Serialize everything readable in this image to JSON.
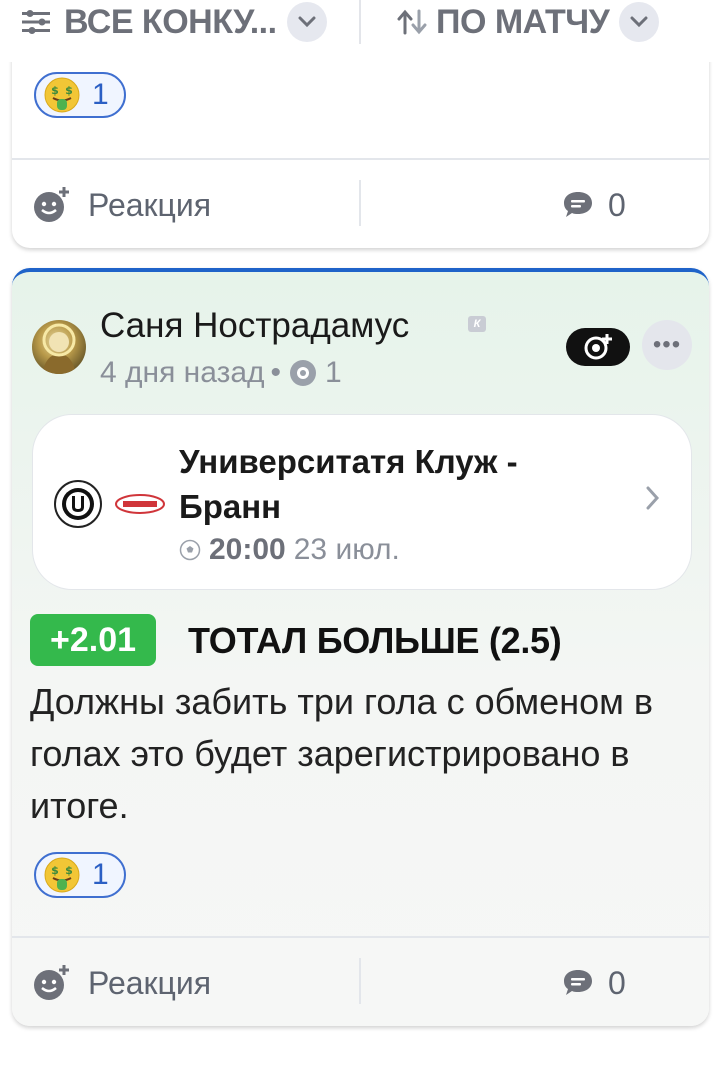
{
  "topbar": {
    "filter_label": "ВСЕ КОНКУ...",
    "sort_label": "ПО МАТЧУ"
  },
  "prev_post": {
    "reaction_count": "1",
    "reaction_label": "Реакция",
    "comments_count": "0"
  },
  "post": {
    "author": "Саня Нострадамус",
    "author_badge": "К",
    "time_ago": "4 дня назад",
    "views": "1",
    "match": {
      "title": "Университатя Клуж - Бранн",
      "time": "20:00",
      "date": "23 июл."
    },
    "odds": "+2.01",
    "bet": "ТОТАЛ БОЛЬШЕ (2.5)",
    "text": "Должны забить три гола с обменом в голах это будет зарегистрировано в итоге.",
    "reaction_count": "1",
    "reaction_label": "Реакция",
    "comments_count": "0"
  },
  "colors": {
    "accent": "#1f63c9",
    "odds_green": "#34b94c",
    "muted": "#8a8f99"
  }
}
